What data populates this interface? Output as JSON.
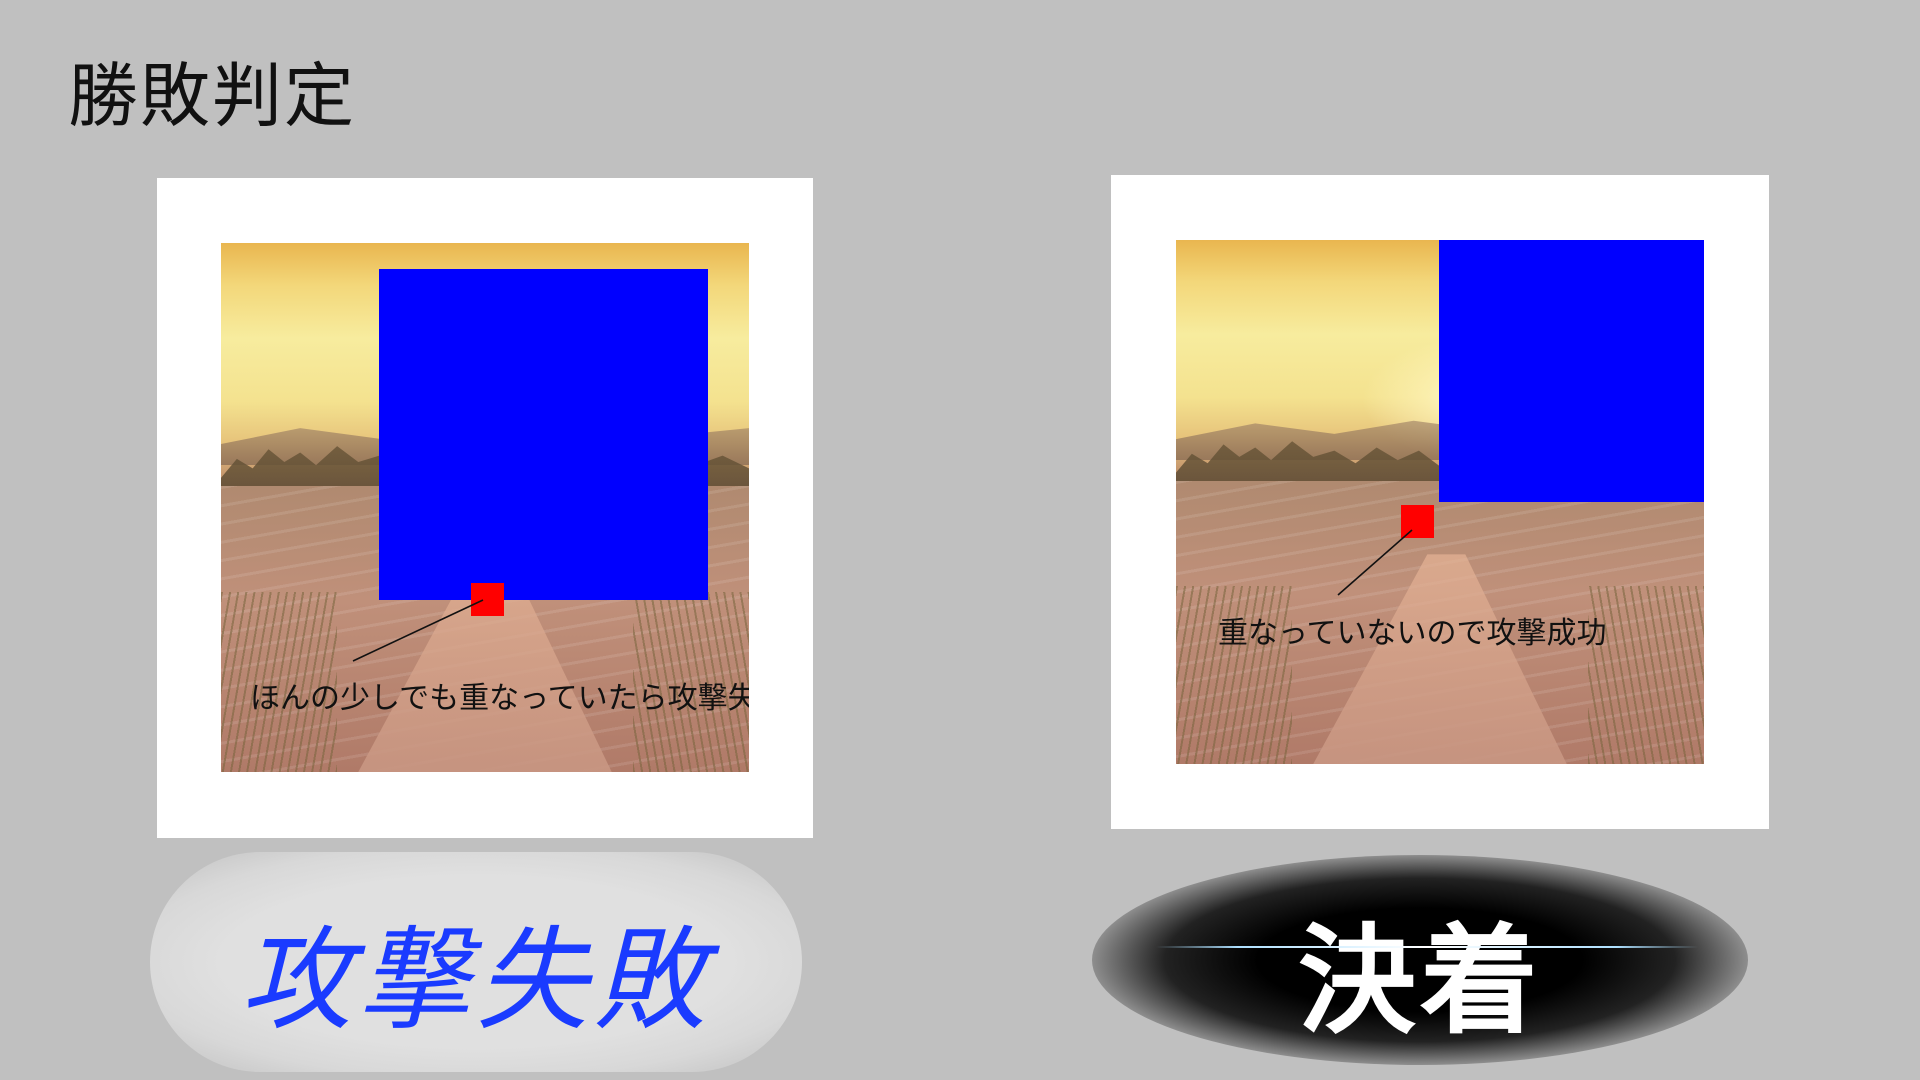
{
  "slide": {
    "title": "勝敗判定"
  },
  "panels": [
    {
      "annotation": "ほんの少しでも重なっていたら攻撃失敗",
      "result": "攻撃失敗"
    },
    {
      "annotation": "重なっていないので攻撃成功",
      "result": "決着"
    }
  ],
  "colors": {
    "background": "#c0c0c0",
    "panel": "#ffffff",
    "enemy_box": "#0000ff",
    "player_box": "#ff0000",
    "fail_text": "#1a3bff",
    "success_text": "#ffffff"
  }
}
